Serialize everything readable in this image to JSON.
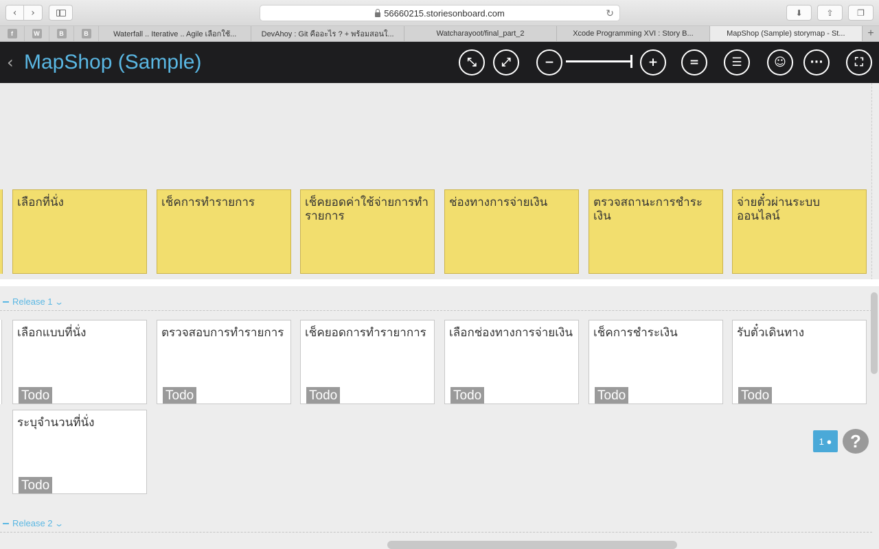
{
  "browser": {
    "url": "56660215.storiesonboard.com",
    "tabs": [
      "Waterfall .. Iterative .. Agile เลือกใช้...",
      "DevAhoy : Git คืออะไร ? + พร้อมสอนใ...",
      "Watcharayoot/final_part_2",
      "Xcode Programming XVI : Story B...",
      "MapShop (Sample) storymap - St..."
    ],
    "favicons": [
      "f",
      "W",
      "B",
      "B"
    ]
  },
  "app": {
    "title": "MapShop (Sample)",
    "back_glyph": "‹"
  },
  "activities": [
    "เลือกที่นั่ง",
    "เช็คการทำรายการ",
    "เช็คยอดค่าใช้จ่ายการทำรายการ",
    "ช่องทางการจ่ายเงิน",
    "ตรวจสถานะการชำระเงิน",
    "จ่ายตั๋วผ่านระบบออนไลน์"
  ],
  "release1": {
    "label": "Release 1",
    "stories_row1": [
      {
        "title": "เลือกแบบที่นั่ง",
        "status": "Todo"
      },
      {
        "title": "ตรวจสอบการทำรายการ",
        "status": "Todo"
      },
      {
        "title": "เช็คยอดการทำรายาการ",
        "status": "Todo"
      },
      {
        "title": "เลือกช่องทางการจ่ายเงิน",
        "status": "Todo"
      },
      {
        "title": "เช็คการชำระเงิน",
        "status": "Todo"
      },
      {
        "title": "รับตั๋วเดินทาง",
        "status": "Todo"
      }
    ],
    "stories_row2": [
      {
        "title": "ระบุจำนวนที่นั่ง",
        "status": "Todo"
      }
    ]
  },
  "release2": {
    "label": "Release 2"
  },
  "online_users": "1",
  "help_glyph": "?",
  "colors": {
    "accent": "#5ab7e3",
    "header_bg": "#1d1d1f",
    "activity_card": "#f2de6e",
    "todo_badge": "#9a9a9a"
  }
}
